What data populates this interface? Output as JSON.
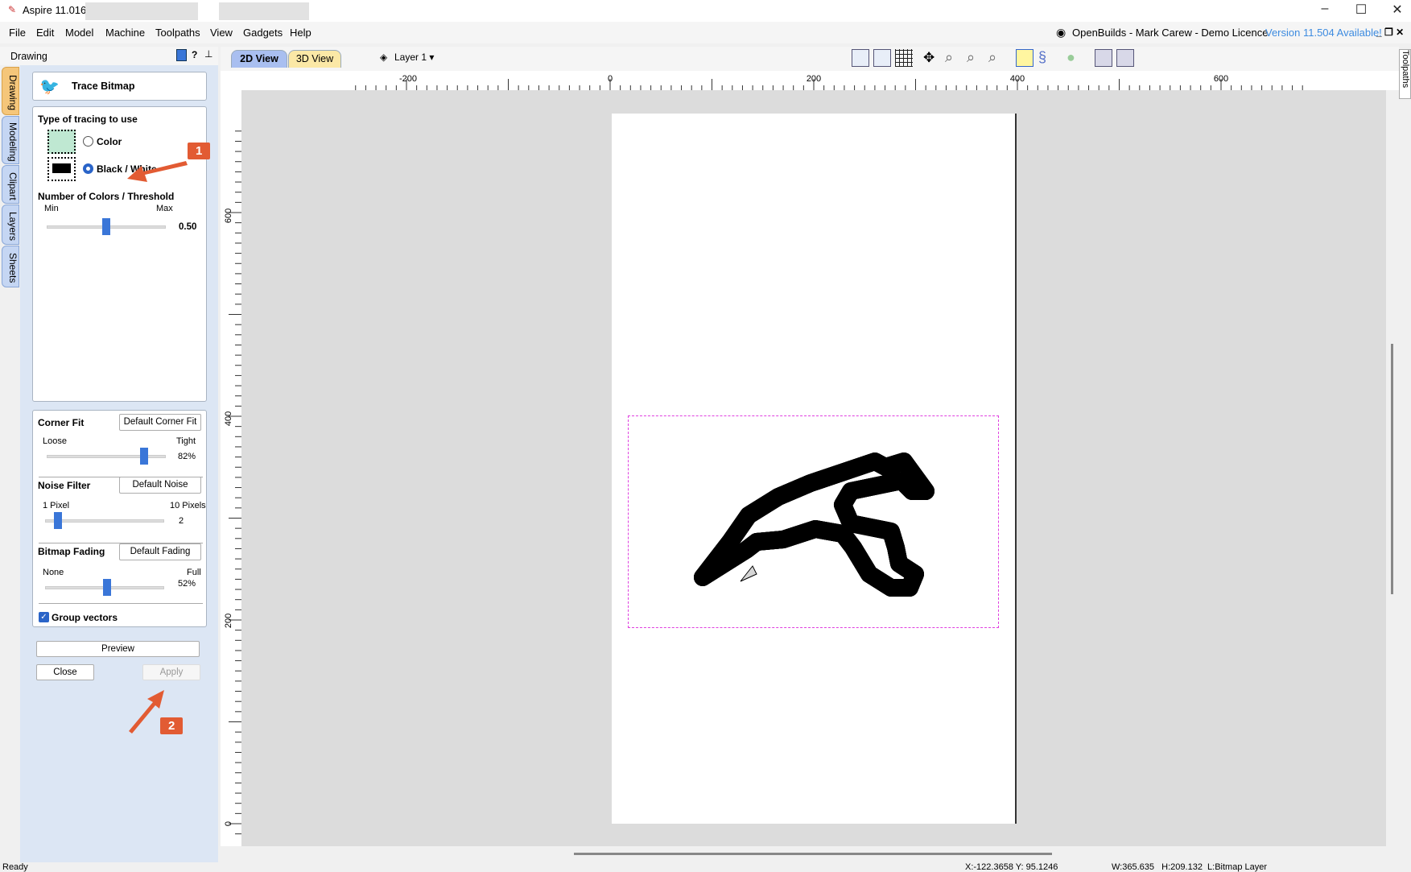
{
  "window": {
    "title": "Aspire 11.016 -",
    "minimize": "–",
    "maximize": "☐",
    "close": "✕"
  },
  "menu": [
    "File",
    "Edit",
    "Model",
    "Machine",
    "Toolpaths",
    "View",
    "Gadgets",
    "Help"
  ],
  "licence": "OpenBuilds - Mark Carew - Demo Licence",
  "version_notice": "Version 11.504 Available!",
  "panel": {
    "header": "Drawing",
    "side_tabs": [
      "Drawing",
      "Modeling",
      "Clipart",
      "Layers",
      "Sheets"
    ],
    "right_tab": "Toolpaths",
    "tool_title": "Trace Bitmap",
    "tracing_type_heading": "Type of tracing to use",
    "options": [
      {
        "label": "Color",
        "selected": false
      },
      {
        "label": "Black / White",
        "selected": true
      }
    ],
    "threshold": {
      "heading": "Number of Colors / Threshold",
      "min": "Min",
      "max": "Max",
      "value": "0.50",
      "fraction": 0.5
    },
    "corner_fit": {
      "heading": "Corner Fit",
      "button": "Default Corner Fit",
      "min": "Loose",
      "max": "Tight",
      "value": "82%",
      "fraction": 0.82
    },
    "noise_filter": {
      "heading": "Noise Filter",
      "button": "Default Noise",
      "min": "1 Pixel",
      "max": "10 Pixels",
      "value": "2",
      "fraction": 0.11
    },
    "bitmap_fading": {
      "heading": "Bitmap Fading",
      "button": "Default Fading",
      "min": "None",
      "max": "Full",
      "value": "52%",
      "fraction": 0.52
    },
    "group_vectors": {
      "label": "Group vectors",
      "checked": true
    },
    "preview": "Preview",
    "close": "Close",
    "apply": "Apply"
  },
  "annotations": {
    "one": "1",
    "two": "2",
    "color": "#e25b33"
  },
  "view_tabs": [
    "2D View",
    "3D View"
  ],
  "layer": "Layer 1 ▾",
  "ruler": {
    "h_labels": [
      "-200",
      "0",
      "200",
      "400",
      "600"
    ],
    "v_labels": [
      "600",
      "400",
      "200",
      "0"
    ]
  },
  "status": {
    "left": "Ready",
    "coords": "X:-122.3658 Y: 95.1246",
    "dims": "W:365.635   H:209.132  L:Bitmap Layer"
  }
}
